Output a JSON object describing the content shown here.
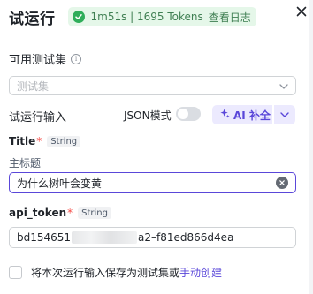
{
  "header": {
    "title": "试运行",
    "status_text": "1m51s | 1695 Tokens",
    "view_log": "查看日志"
  },
  "testset": {
    "label": "可用测试集",
    "info_glyph": "i",
    "placeholder": "测试集"
  },
  "run_input": {
    "label": "试运行输入",
    "json_mode_label": "JSON模式",
    "json_mode_on": false,
    "ai_fill_label": "AI 补全"
  },
  "fields": [
    {
      "name": "Title",
      "required_mark": "*",
      "type": "String",
      "description": "主标题",
      "value": "为什么树叶会变黄"
    },
    {
      "name": "api_token",
      "required_mark": "*",
      "type": "String",
      "value_prefix": "bd154651",
      "value_suffix": "a2–f81ed866d4ea"
    }
  ],
  "save": {
    "text": "将本次运行输入保存为测试集或",
    "link": "手动创建",
    "checked": false
  },
  "colors": {
    "accent": "#5a47d9",
    "success": "#2fae5a",
    "success_bg": "#e5f7e9",
    "required": "#f54a45"
  },
  "icons": {
    "status": "check-circle-icon",
    "close": "close-icon",
    "info": "info-icon",
    "select_chevron": "chevron-down-icon",
    "ai": "sparkle-icon",
    "clear": "clear-circle-icon"
  }
}
